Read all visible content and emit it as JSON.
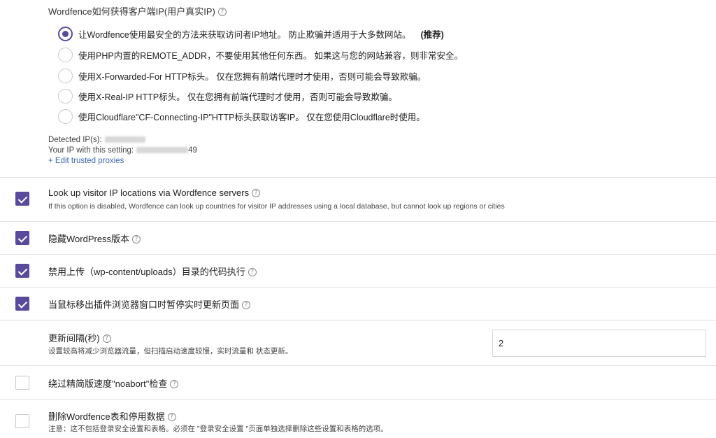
{
  "ip_section": {
    "title": "Wordfence如何获得客户端IP(用户真实IP)",
    "options": [
      {
        "label": "让Wordfence使用最安全的方法来获取访问者IP地址。 防止欺骗并适用于大多数网站。",
        "badge": "(推荐)",
        "checked": true
      },
      {
        "label": "使用PHP内置的REMOTE_ADDR，不要使用其他任何东西。 如果这与您的网站兼容，则非常安全。",
        "badge": "",
        "checked": false
      },
      {
        "label": "使用X-Forwarded-For HTTP标头。 仅在您拥有前端代理时才使用，否则可能会导致欺骗。",
        "badge": "",
        "checked": false
      },
      {
        "label": "使用X-Real-IP HTTP标头。 仅在您拥有前端代理时才使用，否则可能会导致欺骗。",
        "badge": "",
        "checked": false
      },
      {
        "label": "使用Cloudflare\"CF-Connecting-IP\"HTTP标头获取访客IP。 仅在您使用Cloudflare时使用。",
        "badge": "",
        "checked": false
      }
    ],
    "detected_label": "Detected IP(s):",
    "your_ip_label": "Your IP with this setting:",
    "your_ip_suffix": "49",
    "edit_link": "+ Edit trusted proxies"
  },
  "options": [
    {
      "title": "Look up visitor IP locations via Wordfence servers",
      "desc": "If this option is disabled, Wordfence can look up countries for visitor IP addresses using a local database, but cannot look up regions or cities",
      "checked": true
    },
    {
      "title": "隐藏WordPress版本",
      "desc": "",
      "checked": true
    },
    {
      "title": "禁用上传（wp-content/uploads）目录的代码执行",
      "desc": "",
      "checked": true
    },
    {
      "title": "当鼠标移出插件浏览器窗口时暂停实时更新页面",
      "desc": "",
      "checked": true
    }
  ],
  "interval": {
    "title": "更新间隔(秒)",
    "desc": "设置较高将减少浏览器流量，但扫描启动速度较慢，实时流量和 状态更新。",
    "value": "2"
  },
  "options2": [
    {
      "title": "绕过精简版速度\"noabort\"检查",
      "desc": "",
      "checked": false
    },
    {
      "title": "删除Wordfence表和停用数据",
      "desc": "注意：这不包括登录安全设置和表格。必须在 \"登录安全设置 \"页面单独选择删除这些设置和表格的选项。",
      "checked": false
    }
  ],
  "help_glyph": "?"
}
